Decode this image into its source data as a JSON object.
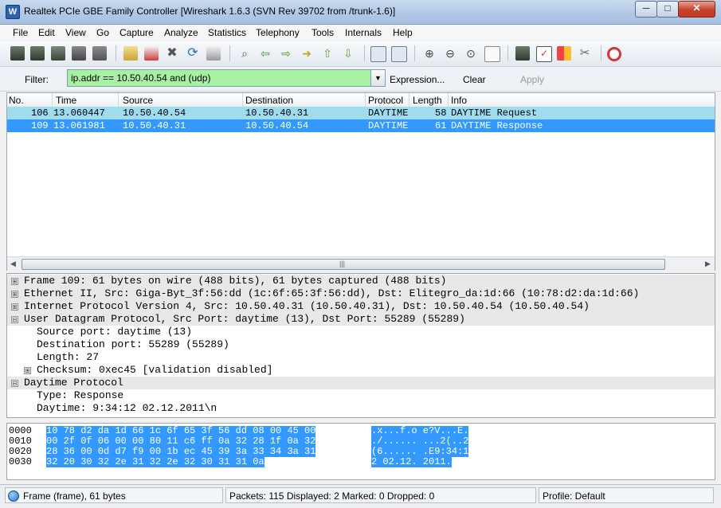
{
  "window": {
    "title": "Realtek PCIe GBE Family Controller   [Wireshark 1.6.3  (SVN Rev 39702 from /trunk-1.6)]",
    "min_label": "─",
    "max_label": "□",
    "close_label": "✕"
  },
  "menu": [
    "File",
    "Edit",
    "View",
    "Go",
    "Capture",
    "Analyze",
    "Statistics",
    "Telephony",
    "Tools",
    "Internals",
    "Help"
  ],
  "toolbar": {
    "icons": [
      "interface-list-icon",
      "capture-options-icon",
      "start-capture-icon",
      "stop-capture-icon",
      "restart-capture-icon",
      "open-file-icon",
      "save-file-icon",
      "close-file-icon",
      "reload-icon",
      "print-icon",
      "find-packet-icon",
      "go-back-icon",
      "go-forward-icon",
      "go-to-packet-icon",
      "first-packet-icon",
      "last-packet-icon",
      "colorize-icon",
      "autoscroll-icon",
      "zoom-in-icon",
      "zoom-out-icon",
      "normal-size-icon",
      "resize-columns-icon",
      "capture-filters-icon",
      "display-filters-icon",
      "coloring-rules-icon",
      "preferences-icon",
      "help-icon"
    ]
  },
  "filter": {
    "label": "Filter:",
    "value": "ip.addr == 10.50.40.54 and (udp)",
    "expression": "Expression...",
    "clear": "Clear",
    "apply": "Apply",
    "bg_color": "#a9f1a2"
  },
  "packet_list": {
    "columns": [
      "No.",
      "Time",
      "Source",
      "Destination",
      "Protocol",
      "Length",
      "Info"
    ],
    "rows": [
      {
        "no": "106",
        "time": "13.060447",
        "source": "10.50.40.54",
        "destination": "10.50.40.31",
        "protocol": "DAYTIME",
        "length": "58",
        "info": "DAYTIME Request"
      },
      {
        "no": "109",
        "time": "13.061981",
        "source": "10.50.40.31",
        "destination": "10.50.40.54",
        "protocol": "DAYTIME",
        "length": "61",
        "info": "DAYTIME Response"
      }
    ],
    "selected_color": "#3399ff",
    "row_color": "#9fdcef"
  },
  "details": [
    {
      "text": "Frame 109: 61 bytes on wire (488 bits), 61 bytes captured (488 bits)",
      "expander": "⊞"
    },
    {
      "text": "Ethernet II, Src: Giga-Byt_3f:56:dd (1c:6f:65:3f:56:dd), Dst: Elitegro_da:1d:66 (10:78:d2:da:1d:66)",
      "expander": "⊞"
    },
    {
      "text": "Internet Protocol Version 4, Src: 10.50.40.31 (10.50.40.31), Dst: 10.50.40.54 (10.50.40.54)",
      "expander": "⊞"
    },
    {
      "text": "User Datagram Protocol, Src Port: daytime (13), Dst Port: 55289 (55289)",
      "expander": "⊟"
    },
    {
      "text": "Source port: daytime (13)"
    },
    {
      "text": "Destination port: 55289 (55289)"
    },
    {
      "text": "Length: 27"
    },
    {
      "text": "Checksum: 0xec45 [validation disabled]",
      "expander": "⊞"
    },
    {
      "text": "Daytime Protocol",
      "expander": "⊟"
    },
    {
      "text": "Type: Response"
    },
    {
      "text": "Daytime: 9:34:12 02.12.2011\\n"
    }
  ],
  "bytes": [
    {
      "offset": "0000",
      "hex": "10 78 d2 da 1d 66 1c 6f  65 3f 56 dd 08 00 45 00",
      "ascii": ".x...f.o e?V...E."
    },
    {
      "offset": "0010",
      "hex": "00 2f 0f 06 00 00 80 11  c6 ff 0a 32 28 1f 0a 32",
      "ascii": "./...... ...2(..2"
    },
    {
      "offset": "0020",
      "hex": "28 36 00 0d d7 f9 00 1b  ec 45 39 3a 33 34 3a 31",
      "ascii": "(6...... .E9:34:1"
    },
    {
      "offset": "0030",
      "hex": "32 20 30 32 2e 31 32 2e  32 30 31 31 0a",
      "ascii": "2 02.12. 2011."
    }
  ],
  "status": {
    "frame": "Frame (frame), 61 bytes",
    "packets": "Packets: 115 Displayed: 2 Marked: 0 Dropped: 0",
    "profile": "Profile: Default"
  }
}
